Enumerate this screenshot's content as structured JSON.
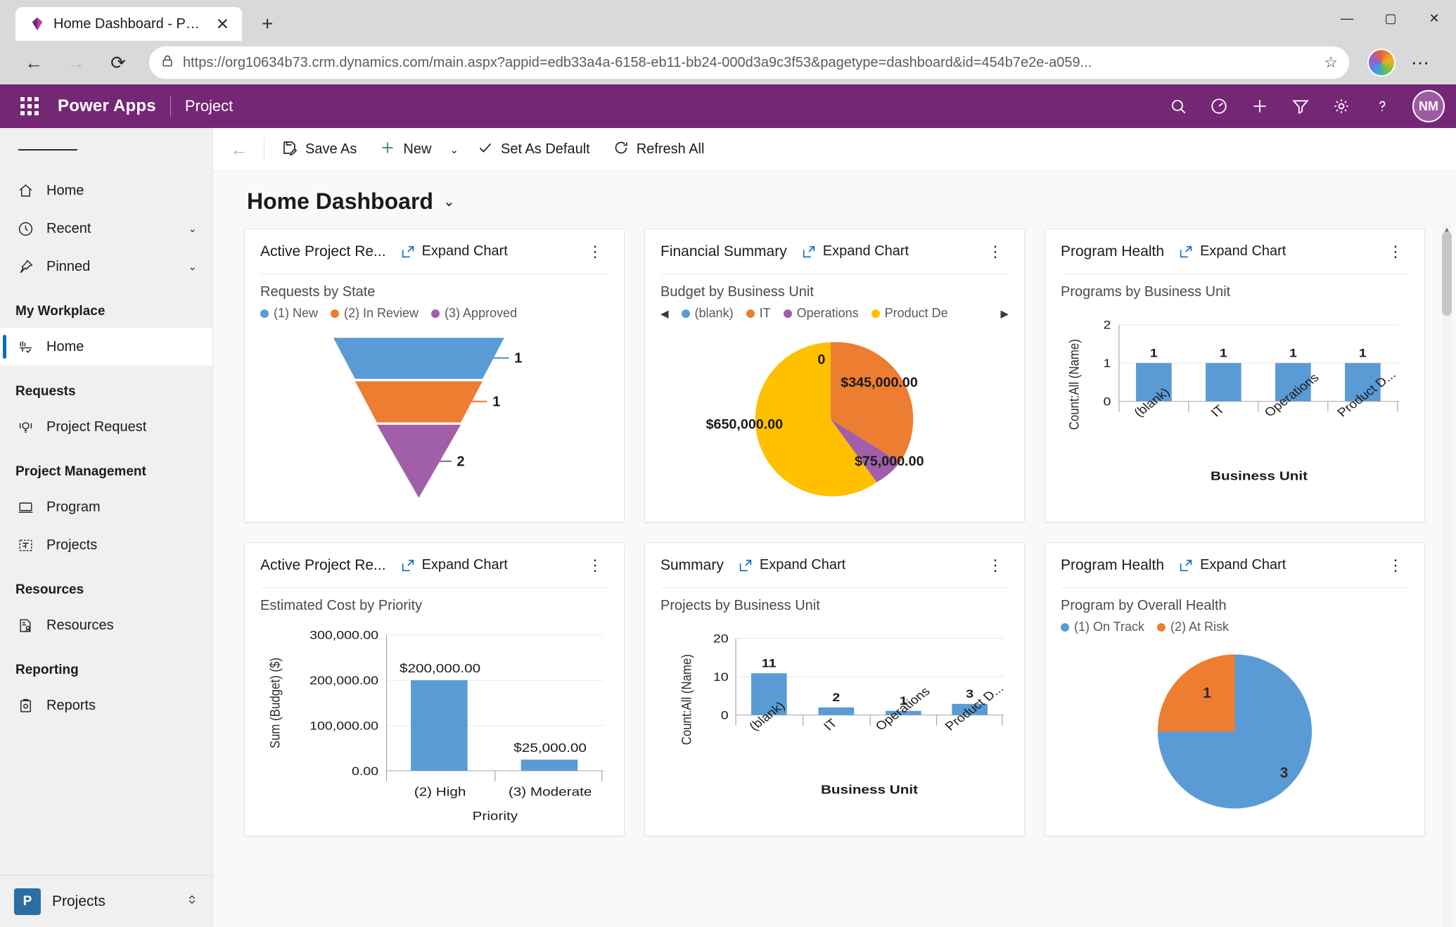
{
  "browser": {
    "tab_title": "Home Dashboard - Power Apps",
    "tab_close": "✕",
    "new_tab": "+",
    "minimize": "—",
    "maximize": "▢",
    "close": "✕",
    "back": "←",
    "forward": "→",
    "reload": "⟳",
    "url": "https://org10634b73.crm.dynamics.com/main.aspx?appid=edb33a4a-6158-eb11-bb24-000d3a9c3f53&pagetype=dashboard&id=454b7e2e-a059...",
    "url_domain": "org10634b73.crm.dynamics.com",
    "star": "☆",
    "more": "⋯"
  },
  "header": {
    "brand": "Power Apps",
    "app_name": "Project",
    "avatar_initials": "NM",
    "icons": [
      "search-icon",
      "assistant-icon",
      "add-icon",
      "filter-icon",
      "settings-icon",
      "help-icon"
    ],
    "accent_color": "#742774"
  },
  "sidebar": {
    "top_items": [
      {
        "label": "Home",
        "icon": "home-icon",
        "chevron": ""
      },
      {
        "label": "Recent",
        "icon": "clock-icon",
        "chevron": "⌄"
      },
      {
        "label": "Pinned",
        "icon": "pin-icon",
        "chevron": "⌄"
      }
    ],
    "groups": [
      {
        "title": "My Workplace",
        "items": [
          {
            "label": "Home",
            "icon": "dashboard-icon",
            "selected": true
          }
        ]
      },
      {
        "title": "Requests",
        "items": [
          {
            "label": "Project Request",
            "icon": "lightbulb-icon",
            "selected": false
          }
        ]
      },
      {
        "title": "Project Management",
        "items": [
          {
            "label": "Program",
            "icon": "program-icon",
            "selected": false
          },
          {
            "label": "Projects",
            "icon": "projects-icon",
            "selected": false
          }
        ]
      },
      {
        "title": "Resources",
        "items": [
          {
            "label": "Resources",
            "icon": "resources-icon",
            "selected": false
          }
        ]
      },
      {
        "title": "Reporting",
        "items": [
          {
            "label": "Reports",
            "icon": "reports-icon",
            "selected": false
          }
        ]
      }
    ],
    "footer": {
      "badge": "P",
      "label": "Projects",
      "chevron": "⌃⌄"
    }
  },
  "commandbar": {
    "back": "←",
    "save_as": "Save As",
    "new": "New",
    "new_caret": "⌄",
    "set_as_default": "Set As Default",
    "refresh_all": "Refresh All"
  },
  "page": {
    "title": "Home Dashboard",
    "caret": "⌄"
  },
  "common": {
    "expand_chart": "Expand Chart",
    "more_menu": "⋮"
  },
  "colors": {
    "blue": "#5b9bd5",
    "orange": "#ed7d31",
    "purple": "#a05fa8",
    "yellow": "#ffc000",
    "grid": "#e8e8e8",
    "axis": "#a6a6a6"
  },
  "cards": [
    {
      "title": "Active Project Re...",
      "chart_index": 0
    },
    {
      "title": "Financial Summary",
      "chart_index": 1
    },
    {
      "title": "Program Health",
      "chart_index": 2
    },
    {
      "title": "Active Project Re...",
      "chart_index": 3
    },
    {
      "title": "Summary",
      "chart_index": 4
    },
    {
      "title": "Program Health",
      "chart_index": 5
    }
  ],
  "chart_data": [
    {
      "type": "funnel",
      "title": "Requests by State",
      "categories": [
        "(1) New",
        "(2) In Review",
        "(3) Approved"
      ],
      "values": [
        1,
        1,
        2
      ],
      "colors": [
        "#5b9bd5",
        "#ed7d31",
        "#a05fa8"
      ],
      "legend": [
        "(1) New",
        "(2) In Review",
        "(3) Approved"
      ],
      "legend_position": "top",
      "xlabel": "",
      "ylabel": ""
    },
    {
      "type": "pie",
      "title": "Budget by Business Unit",
      "categories": [
        "(blank)",
        "IT",
        "Operations",
        "Product De"
      ],
      "values": [
        0,
        345000,
        75000,
        650000
      ],
      "value_labels": [
        "0",
        "$345,000.00",
        "$75,000.00",
        "$650,000.00"
      ],
      "colors": [
        "#5b9bd5",
        "#ed7d31",
        "#a05fa8",
        "#ffc000"
      ],
      "legend": [
        "(blank)",
        "IT",
        "Operations",
        "Product De"
      ],
      "legend_position": "top",
      "legend_prev_arrow": "◀",
      "legend_next_arrow": "▶"
    },
    {
      "type": "bar",
      "title": "Programs by Business Unit",
      "categories": [
        "(blank)",
        "IT",
        "Operations",
        "Product D..."
      ],
      "values": [
        1,
        1,
        1,
        1
      ],
      "value_labels": [
        "1",
        "1",
        "1",
        "1"
      ],
      "yticks": [
        "0",
        "1",
        "2"
      ],
      "ylim": [
        0,
        2
      ],
      "ylabel": "Count:All (Name)",
      "xlabel": "Business Unit",
      "grid": true,
      "color": "#5b9bd5"
    },
    {
      "type": "bar",
      "title": "Estimated Cost by Priority",
      "categories": [
        "(2) High",
        "(3) Moderate"
      ],
      "values": [
        200000,
        25000
      ],
      "value_labels": [
        "$200,000.00",
        "$25,000.00"
      ],
      "yticks": [
        "0.00",
        "100,000.00",
        "200,000.00",
        "300,000.00"
      ],
      "ylim": [
        0,
        300000
      ],
      "ylabel": "Sum (Budget) ($)",
      "xlabel": "Priority",
      "grid": true,
      "color": "#5b9bd5"
    },
    {
      "type": "bar",
      "title": "Projects by Business Unit",
      "categories": [
        "(blank)",
        "IT",
        "Operations",
        "Product D..."
      ],
      "values": [
        11,
        2,
        1,
        3
      ],
      "value_labels": [
        "11",
        "2",
        "1",
        "3"
      ],
      "yticks": [
        "0",
        "10",
        "20"
      ],
      "ylim": [
        0,
        20
      ],
      "ylabel": "Count:All (Name)",
      "xlabel": "Business Unit",
      "grid": true,
      "color": "#5b9bd5"
    },
    {
      "type": "pie",
      "title": "Program by Overall Health",
      "categories": [
        "(1) On Track",
        "(2) At Risk"
      ],
      "values": [
        3,
        1
      ],
      "value_labels": [
        "3",
        "1"
      ],
      "colors": [
        "#5b9bd5",
        "#ed7d31"
      ],
      "legend": [
        "(1) On Track",
        "(2) At Risk"
      ],
      "legend_position": "top"
    }
  ]
}
